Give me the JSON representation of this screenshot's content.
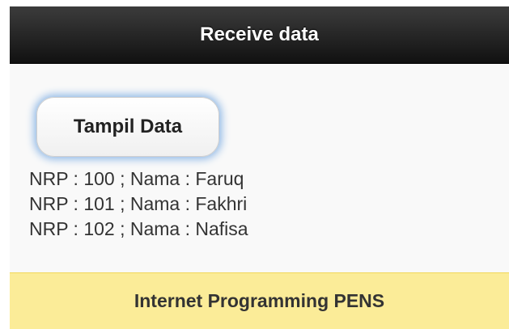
{
  "header": {
    "title": "Receive data"
  },
  "main": {
    "button_label": "Tampil Data",
    "results": [
      "NRP : 100 ; Nama : Faruq",
      "NRP : 101 ; Nama : Fakhri",
      "NRP : 102 ; Nama : Nafisa"
    ]
  },
  "footer": {
    "text": "Internet Programming PENS"
  },
  "colors": {
    "header_bg": "#1a1a1a",
    "footer_bg": "#fbec98",
    "button_glow": "#8fb8e6"
  }
}
